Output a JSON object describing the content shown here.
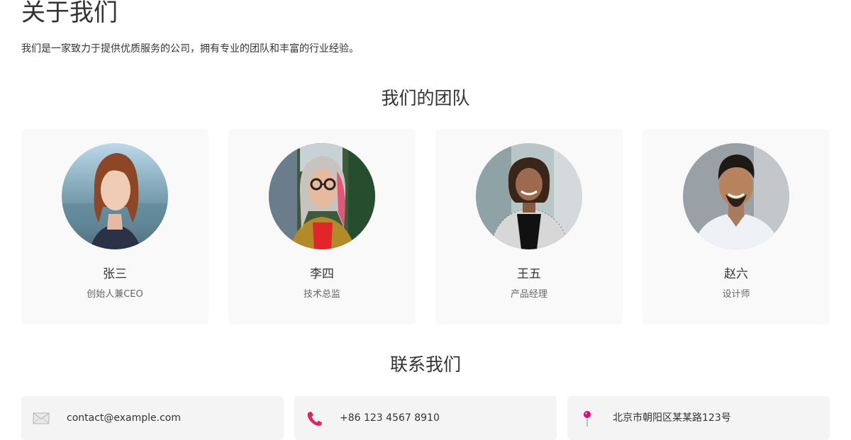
{
  "about": {
    "title": "关于我们",
    "description": "我们是一家致力于提供优质服务的公司，拥有专业的团队和丰富的行业经验。"
  },
  "team": {
    "title": "我们的团队",
    "members": [
      {
        "name": "张三",
        "role": "创始人兼CEO",
        "photo": "portrait-woman-red-hair"
      },
      {
        "name": "李四",
        "role": "技术总监",
        "photo": "portrait-woman-glasses"
      },
      {
        "name": "王五",
        "role": "产品经理",
        "photo": "portrait-woman-blazer"
      },
      {
        "name": "赵六",
        "role": "设计师",
        "photo": "portrait-man-smiling"
      }
    ]
  },
  "contact": {
    "title": "联系我们",
    "items": [
      {
        "icon": "envelope-icon",
        "text": "contact@example.com"
      },
      {
        "icon": "phone-icon",
        "text": "+86 123 4567 8910"
      },
      {
        "icon": "location-pin-icon",
        "text": "北京市朝阳区某某路123号"
      }
    ]
  },
  "colors": {
    "card_bg": "#f9f9f9",
    "contact_bg": "#f4f4f4",
    "phone_icon": "#e0245e",
    "pin_icon": "#e6007e"
  }
}
